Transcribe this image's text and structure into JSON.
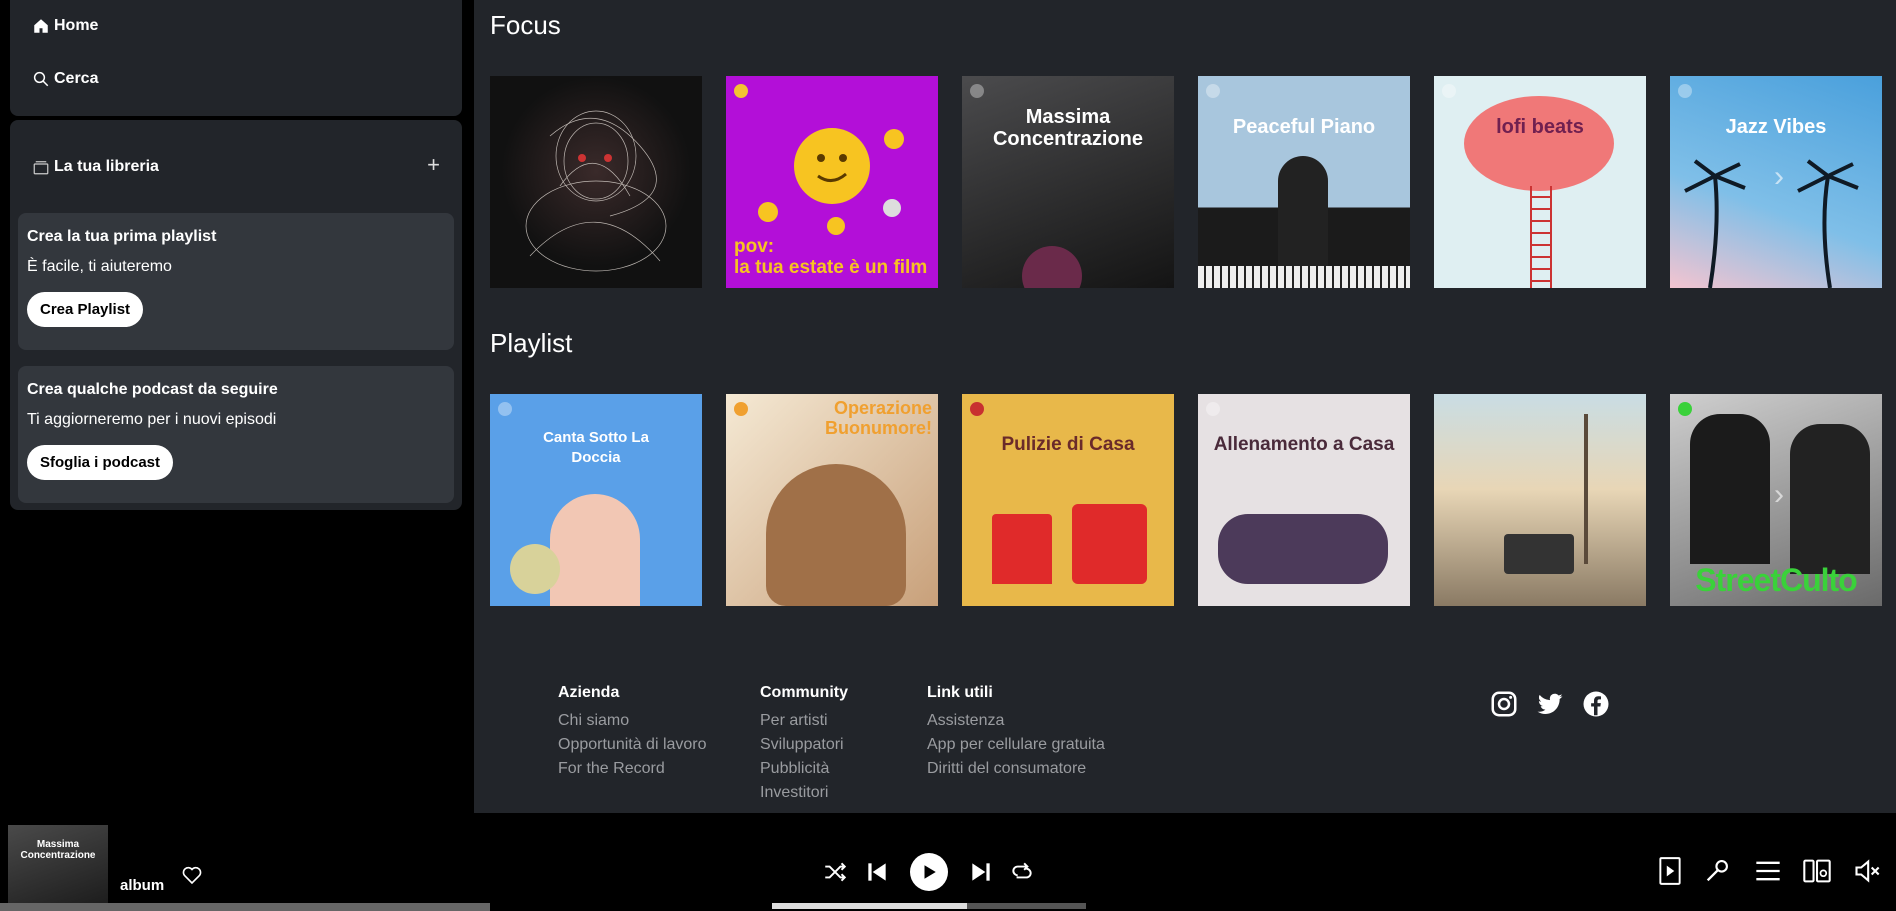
{
  "nav": {
    "home": "Home",
    "search": "Cerca"
  },
  "library": {
    "title": "La tua libreria",
    "add": "+",
    "playlist_card": {
      "title": "Crea la tua prima playlist",
      "subtitle": "È facile, ti aiuteremo",
      "button": "Crea Playlist"
    },
    "podcast_card": {
      "title": "Crea qualche podcast da seguire",
      "subtitle": "Ti aggiorneremo per i nuovi episodi",
      "button": "Sfoglia i podcast"
    }
  },
  "sections": {
    "focus": {
      "title": "Focus",
      "tiles": [
        "",
        "pov:\nla tua estate è un film",
        "Massima Concentrazione",
        "Peaceful Piano",
        "lofi beats",
        "Jazz Vibes"
      ]
    },
    "playlist": {
      "title": "Playlist",
      "tiles": [
        "Canta Sotto La Doccia",
        "Operazione Buonumore!",
        "Pulizie di Casa",
        "Allenamento a Casa",
        "",
        "StreetCulto"
      ]
    }
  },
  "footer": {
    "azienda": {
      "title": "Azienda",
      "links": [
        "Chi siamo",
        "Opportunità di lavoro",
        "For the Record"
      ]
    },
    "community": {
      "title": "Community",
      "links": [
        "Per artisti",
        "Sviluppatori",
        "Pubblicità",
        "Investitori"
      ]
    },
    "link_utili": {
      "title": "Link utili",
      "links": [
        "Assistenza",
        "App per cellulare gratuita",
        "Diritti del consumatore"
      ]
    }
  },
  "player": {
    "cover_text": "Massima Concentrazione",
    "title": "album",
    "progress": 0.62
  }
}
